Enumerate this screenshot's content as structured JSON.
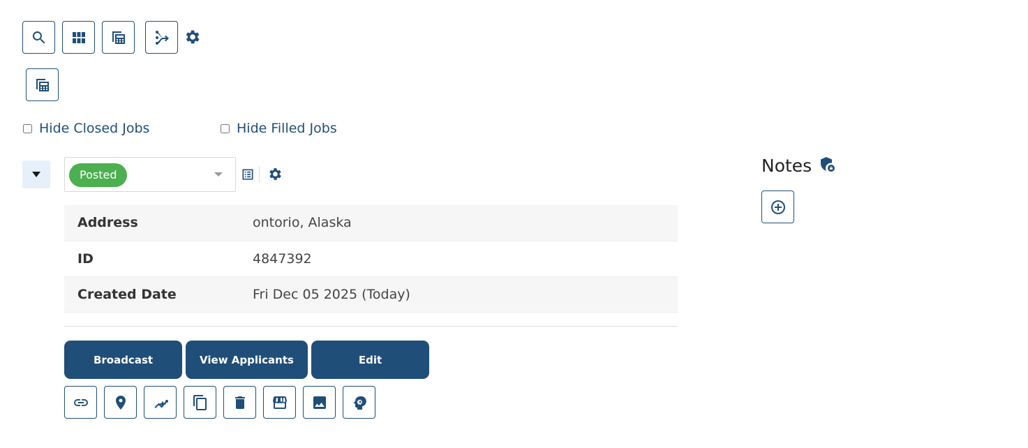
{
  "toolbar": {
    "icons": [
      "search-icon",
      "grid-icon",
      "calculator-icon",
      "share-flow-icon",
      "gear-icon"
    ],
    "secondary_icon": "calculator-icon"
  },
  "filters": {
    "hide_closed_label": "Hide Closed Jobs",
    "hide_closed_checked": false,
    "hide_filled_label": "Hide Filled Jobs",
    "hide_filled_checked": false
  },
  "job": {
    "status": "Posted",
    "status_color": "#4caf50",
    "details": [
      {
        "label": "Address",
        "value": "ontorio, Alaska"
      },
      {
        "label": "ID",
        "value": "4847392"
      },
      {
        "label": "Created Date",
        "value": "Fri Dec 05 2025 (Today)"
      }
    ],
    "actions": {
      "broadcast": "Broadcast",
      "view_applicants": "View Applicants",
      "edit": "Edit"
    },
    "tool_icons": [
      "link-icon",
      "location-pin-icon",
      "sparkle-chart-icon",
      "copy-icon",
      "trash-icon",
      "storefront-icon",
      "image-icon",
      "head-gear-icon"
    ]
  },
  "notes": {
    "title": "Notes",
    "badge_icon": "shield-lock-icon",
    "add_icon": "plus-circle-icon"
  },
  "colors": {
    "primary": "#1f4e79",
    "status_posted": "#4caf50",
    "toggle_bg": "#e6f0fb"
  }
}
